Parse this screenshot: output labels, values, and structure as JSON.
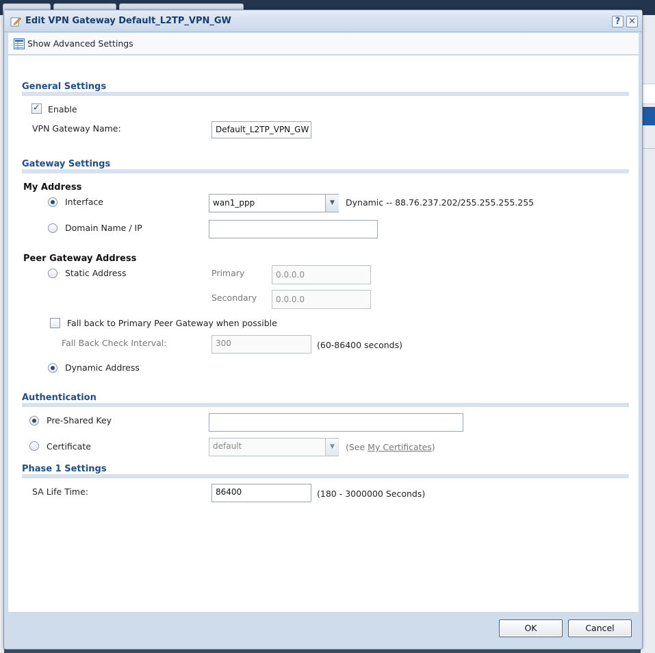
{
  "dialog": {
    "title": "Edit VPN Gateway Default_L2TP_VPN_GW",
    "help_label": "?",
    "close_label": "✕"
  },
  "toolbar": {
    "advanced_label": "Show Advanced Settings"
  },
  "general": {
    "title": "General Settings",
    "enable_label": "Enable",
    "enable_checked": true,
    "name_label": "VPN Gateway Name:",
    "name_value": "Default_L2TP_VPN_GW"
  },
  "gateway": {
    "title": "Gateway Settings",
    "my_address": {
      "title": "My Address",
      "interface_label": "Interface",
      "interface_value": "wan1_ppp",
      "interface_info": "Dynamic -- 88.76.237.202/255.255.255.255",
      "domain_label": "Domain Name / IP",
      "domain_value": ""
    },
    "peer": {
      "title": "Peer Gateway Address",
      "static_label": "Static Address",
      "primary_label": "Primary",
      "primary_value": "0.0.0.0",
      "secondary_label": "Secondary",
      "secondary_value": "0.0.0.0",
      "fallback_label": "Fall back to Primary Peer Gateway when possible",
      "fallback_interval_label": "Fall Back Check Interval:",
      "fallback_interval_value": "300",
      "fallback_interval_hint": "(60-86400 seconds)",
      "dynamic_label": "Dynamic Address"
    }
  },
  "auth": {
    "title": "Authentication",
    "psk_label": "Pre-Shared Key",
    "psk_value": "",
    "cert_label": "Certificate",
    "cert_value": "default",
    "cert_hint_prefix": "(See ",
    "cert_link": "My Certificates",
    "cert_hint_suffix": ")"
  },
  "phase1": {
    "title": "Phase 1 Settings",
    "sa_label": "SA Life Time:",
    "sa_value": "86400",
    "sa_hint": "(180 - 3000000 Seconds)"
  },
  "buttons": {
    "ok": "OK",
    "cancel": "Cancel"
  },
  "colors": {
    "accent": "#1e4f8a",
    "dialog_bg": "#cfdceb",
    "section_bar": "#d9e2ec"
  }
}
